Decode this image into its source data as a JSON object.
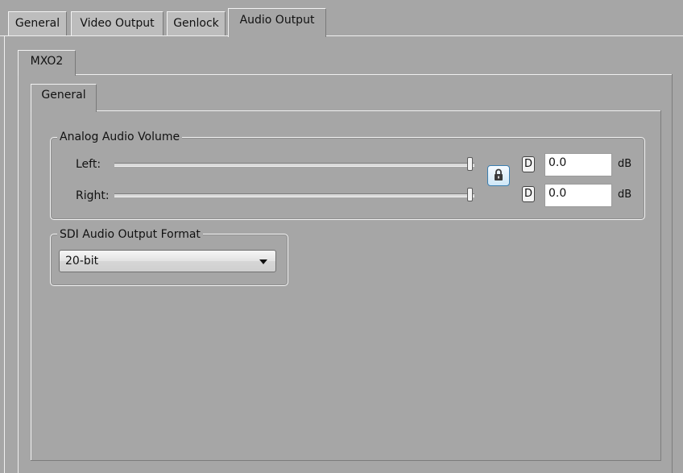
{
  "tabs": [
    {
      "label": "General"
    },
    {
      "label": "Video Output"
    },
    {
      "label": "Genlock"
    },
    {
      "label": "Audio Output"
    }
  ],
  "device_tab": {
    "label": "MXO2"
  },
  "sub_tab": {
    "label": "General"
  },
  "analog_audio": {
    "title": "Analog Audio Volume",
    "left": {
      "label": "Left:",
      "default_button": "D",
      "value": "0.0",
      "unit": "dB",
      "slider_level": 1.0
    },
    "right": {
      "label": "Right:",
      "default_button": "D",
      "value": "0.0",
      "unit": "dB",
      "slider_level": 1.0
    },
    "lock_icon": "lock-icon"
  },
  "sdi_audio": {
    "title": "SDI Audio Output Format",
    "selected": "20-bit"
  },
  "colors": {
    "background": "#a6a6a6",
    "lock_accent": "#3c7fb1"
  }
}
